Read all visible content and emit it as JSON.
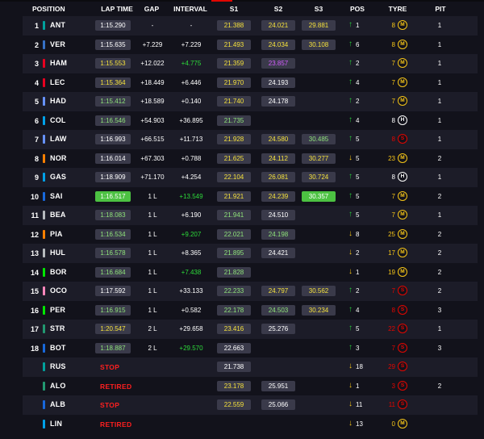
{
  "headers": {
    "position": "POSITION",
    "lap_time": "LAP TIME",
    "gap": "GAP",
    "interval": "INTERVAL",
    "s1": "S1",
    "s2": "S2",
    "s3": "S3",
    "pos_change": "POS",
    "tyre": "TYRE",
    "pit": "PIT"
  },
  "colors": {
    "tyre_medium": "#f5c518",
    "tyre_soft": "#e10600",
    "tyre_hard": "#ffffff",
    "personal_best": "#2ddb3a",
    "session_best": "#cc44ff"
  },
  "rows": [
    {
      "pos": "1",
      "team_color": "#00a19c",
      "driver": "ANT",
      "lap": "1:15.290",
      "lap_style": "",
      "gap": "-",
      "interval": "-",
      "int_style": "",
      "s1": "21.388",
      "s1_style": "yellow",
      "s2": "24.021",
      "s2_style": "yellow",
      "s3": "29.881",
      "s3_style": "yellow",
      "dir": "up",
      "arrow": "↑",
      "pc": "1",
      "laps": "8",
      "tyre": "M",
      "tyre_color": "#f5c518",
      "pit": "1"
    },
    {
      "pos": "2",
      "team_color": "#3671c6",
      "driver": "VER",
      "lap": "1:15.635",
      "lap_style": "",
      "gap": "+7.229",
      "interval": "+7.229",
      "int_style": "",
      "s1": "21.493",
      "s1_style": "yellow",
      "s2": "24.034",
      "s2_style": "yellow",
      "s3": "30.108",
      "s3_style": "yellow",
      "dir": "up",
      "arrow": "↑",
      "pc": "6",
      "laps": "8",
      "tyre": "M",
      "tyre_color": "#f5c518",
      "pit": "1"
    },
    {
      "pos": "3",
      "team_color": "#e80020",
      "driver": "HAM",
      "lap": "1:15.553",
      "lap_style": "yellow",
      "gap": "+12.022",
      "interval": "+4.775",
      "int_style": "green",
      "s1": "21.359",
      "s1_style": "yellow",
      "s2": "23.857",
      "s2_style": "purple",
      "s3": "",
      "s3_style": "",
      "dir": "up",
      "arrow": "↑",
      "pc": "2",
      "laps": "7",
      "tyre": "M",
      "tyre_color": "#f5c518",
      "pit": "1"
    },
    {
      "pos": "4",
      "team_color": "#e80020",
      "driver": "LEC",
      "lap": "1:15.364",
      "lap_style": "yellow",
      "gap": "+18.449",
      "interval": "+6.446",
      "int_style": "",
      "s1": "21.970",
      "s1_style": "yellow",
      "s2": "24.193",
      "s2_style": "",
      "s3": "",
      "s3_style": "",
      "dir": "up",
      "arrow": "↑",
      "pc": "4",
      "laps": "7",
      "tyre": "M",
      "tyre_color": "#f5c518",
      "pit": "1"
    },
    {
      "pos": "5",
      "team_color": "#6692ff",
      "driver": "HAD",
      "lap": "1:15.412",
      "lap_style": "green",
      "gap": "+18.589",
      "interval": "+0.140",
      "int_style": "",
      "s1": "21.740",
      "s1_style": "yellow",
      "s2": "24.178",
      "s2_style": "",
      "s3": "",
      "s3_style": "",
      "dir": "up",
      "arrow": "↑",
      "pc": "2",
      "laps": "7",
      "tyre": "M",
      "tyre_color": "#f5c518",
      "pit": "1"
    },
    {
      "pos": "6",
      "team_color": "#00a1e8",
      "driver": "COL",
      "lap": "1:16.546",
      "lap_style": "green",
      "gap": "+54.903",
      "interval": "+36.895",
      "int_style": "",
      "s1": "21.735",
      "s1_style": "green",
      "s2": "",
      "s2_style": "",
      "s3": "",
      "s3_style": "",
      "dir": "up",
      "arrow": "↑",
      "pc": "4",
      "laps": "8",
      "tyre": "H",
      "tyre_color": "#ffffff",
      "pit": "1"
    },
    {
      "pos": "7",
      "team_color": "#6692ff",
      "driver": "LAW",
      "lap": "1:16.993",
      "lap_style": "",
      "gap": "+66.515",
      "interval": "+11.713",
      "int_style": "",
      "s1": "21.928",
      "s1_style": "yellow",
      "s2": "24.580",
      "s2_style": "yellow",
      "s3": "30.485",
      "s3_style": "green",
      "dir": "up",
      "arrow": "↑",
      "pc": "5",
      "laps": "8",
      "tyre": "S",
      "tyre_color": "#e10600",
      "pit": "1"
    },
    {
      "pos": "8",
      "team_color": "#ff8000",
      "driver": "NOR",
      "lap": "1:16.014",
      "lap_style": "",
      "gap": "+67.303",
      "interval": "+0.788",
      "int_style": "",
      "s1": "21.625",
      "s1_style": "yellow",
      "s2": "24.112",
      "s2_style": "yellow",
      "s3": "30.277",
      "s3_style": "yellow",
      "dir": "down",
      "arrow": "↓",
      "pc": "5",
      "laps": "23",
      "tyre": "M",
      "tyre_color": "#f5c518",
      "pit": "2"
    },
    {
      "pos": "9",
      "team_color": "#00a1e8",
      "driver": "GAS",
      "lap": "1:18.909",
      "lap_style": "",
      "gap": "+71.170",
      "interval": "+4.254",
      "int_style": "",
      "s1": "22.104",
      "s1_style": "yellow",
      "s2": "26.081",
      "s2_style": "yellow",
      "s3": "30.724",
      "s3_style": "yellow",
      "dir": "up",
      "arrow": "↑",
      "pc": "5",
      "laps": "8",
      "tyre": "H",
      "tyre_color": "#ffffff",
      "pit": "1"
    },
    {
      "pos": "10",
      "team_color": "#1868db",
      "driver": "SAI",
      "lap": "1:16.517",
      "lap_style": "gbg",
      "gap": "1 L",
      "interval": "+13.549",
      "int_style": "green",
      "s1": "21.921",
      "s1_style": "yellow",
      "s2": "24.239",
      "s2_style": "yellow",
      "s3": "30.357",
      "s3_style": "gbg",
      "dir": "up",
      "arrow": "↑",
      "pc": "5",
      "laps": "7",
      "tyre": "M",
      "tyre_color": "#f5c518",
      "pit": "2"
    },
    {
      "pos": "11",
      "team_color": "#b6babd",
      "driver": "BEA",
      "lap": "1:18.083",
      "lap_style": "green",
      "gap": "1 L",
      "interval": "+6.190",
      "int_style": "",
      "s1": "21.941",
      "s1_style": "green",
      "s2": "24.510",
      "s2_style": "",
      "s3": "",
      "s3_style": "",
      "dir": "up",
      "arrow": "↑",
      "pc": "5",
      "laps": "7",
      "tyre": "M",
      "tyre_color": "#f5c518",
      "pit": "1"
    },
    {
      "pos": "12",
      "team_color": "#ff8000",
      "driver": "PIA",
      "lap": "1:16.534",
      "lap_style": "green",
      "gap": "1 L",
      "interval": "+9.207",
      "int_style": "green",
      "s1": "22.021",
      "s1_style": "green",
      "s2": "24.198",
      "s2_style": "green",
      "s3": "",
      "s3_style": "",
      "dir": "down",
      "arrow": "↓",
      "pc": "8",
      "laps": "25",
      "tyre": "M",
      "tyre_color": "#f5c518",
      "pit": "2"
    },
    {
      "pos": "13",
      "team_color": "#b6babd",
      "driver": "HUL",
      "lap": "1:16.578",
      "lap_style": "green",
      "gap": "1 L",
      "interval": "+8.365",
      "int_style": "",
      "s1": "21.895",
      "s1_style": "green",
      "s2": "24.421",
      "s2_style": "",
      "s3": "",
      "s3_style": "",
      "dir": "down",
      "arrow": "↓",
      "pc": "2",
      "laps": "17",
      "tyre": "M",
      "tyre_color": "#f5c518",
      "pit": "2"
    },
    {
      "pos": "14",
      "team_color": "#00e701",
      "driver": "BOR",
      "lap": "1:16.684",
      "lap_style": "green",
      "gap": "1 L",
      "interval": "+7.438",
      "int_style": "green",
      "s1": "21.828",
      "s1_style": "green",
      "s2": "",
      "s2_style": "",
      "s3": "",
      "s3_style": "",
      "dir": "down",
      "arrow": "↓",
      "pc": "1",
      "laps": "19",
      "tyre": "M",
      "tyre_color": "#f5c518",
      "pit": "2"
    },
    {
      "pos": "15",
      "team_color": "#ff87bc",
      "driver": "OCO",
      "lap": "1:17.592",
      "lap_style": "",
      "gap": "1 L",
      "interval": "+33.133",
      "int_style": "",
      "s1": "22.233",
      "s1_style": "green",
      "s2": "24.797",
      "s2_style": "yellow",
      "s3": "30.562",
      "s3_style": "yellow",
      "dir": "up",
      "arrow": "↑",
      "pc": "2",
      "laps": "7",
      "tyre": "S",
      "tyre_color": "#e10600",
      "pit": "2"
    },
    {
      "pos": "16",
      "team_color": "#00e701",
      "driver": "PER",
      "lap": "1:16.915",
      "lap_style": "green",
      "gap": "1 L",
      "interval": "+0.582",
      "int_style": "",
      "s1": "22.178",
      "s1_style": "green",
      "s2": "24.503",
      "s2_style": "green",
      "s3": "30.234",
      "s3_style": "yellow",
      "dir": "up",
      "arrow": "↑",
      "pc": "4",
      "laps": "8",
      "tyre": "S",
      "tyre_color": "#e10600",
      "pit": "3"
    },
    {
      "pos": "17",
      "team_color": "#229971",
      "driver": "STR",
      "lap": "1:20.547",
      "lap_style": "yellow",
      "gap": "2 L",
      "interval": "+29.658",
      "int_style": "",
      "s1": "23.416",
      "s1_style": "yellow",
      "s2": "25.276",
      "s2_style": "",
      "s3": "",
      "s3_style": "",
      "dir": "up",
      "arrow": "↑",
      "pc": "5",
      "laps": "22",
      "tyre": "S",
      "tyre_color": "#e10600",
      "pit": "1"
    },
    {
      "pos": "18",
      "team_color": "#1868db",
      "driver": "BOT",
      "lap": "1:18.887",
      "lap_style": "green",
      "gap": "2 L",
      "interval": "+29.570",
      "int_style": "green",
      "s1": "22.663",
      "s1_style": "",
      "s2": "",
      "s2_style": "",
      "s3": "",
      "s3_style": "",
      "dir": "up",
      "arrow": "↑",
      "pc": "3",
      "laps": "7",
      "tyre": "S",
      "tyre_color": "#e10600",
      "pit": "3"
    },
    {
      "pos": "",
      "team_color": "#00a19c",
      "driver": "RUS",
      "status": "STOP",
      "s1": "21.738",
      "s1_style": "",
      "s2": "",
      "s2_style": "",
      "s3": "",
      "s3_style": "",
      "dir": "down",
      "arrow": "↓",
      "pc": "18",
      "laps": "29",
      "tyre": "S",
      "tyre_color": "#e10600",
      "pit": ""
    },
    {
      "pos": "",
      "team_color": "#229971",
      "driver": "ALO",
      "status": "RETIRED",
      "s1": "23.178",
      "s1_style": "yellow",
      "s2": "25.951",
      "s2_style": "",
      "s3": "",
      "s3_style": "",
      "dir": "down",
      "arrow": "↓",
      "pc": "1",
      "laps": "3",
      "tyre": "S",
      "tyre_color": "#e10600",
      "pit": "2"
    },
    {
      "pos": "",
      "team_color": "#1868db",
      "driver": "ALB",
      "status": "STOP",
      "s1": "22.559",
      "s1_style": "yellow",
      "s2": "25.066",
      "s2_style": "",
      "s3": "",
      "s3_style": "",
      "dir": "down",
      "arrow": "↓",
      "pc": "11",
      "laps": "11",
      "tyre": "S",
      "tyre_color": "#e10600",
      "pit": ""
    },
    {
      "pos": "",
      "team_color": "#00a1e8",
      "driver": "LIN",
      "status": "RETIRED",
      "s1": "",
      "s1_style": "",
      "s2": "",
      "s2_style": "",
      "s3": "",
      "s3_style": "",
      "dir": "down",
      "arrow": "↓",
      "pc": "13",
      "laps": "0",
      "tyre": "M",
      "tyre_color": "#f5c518",
      "pit": ""
    }
  ]
}
